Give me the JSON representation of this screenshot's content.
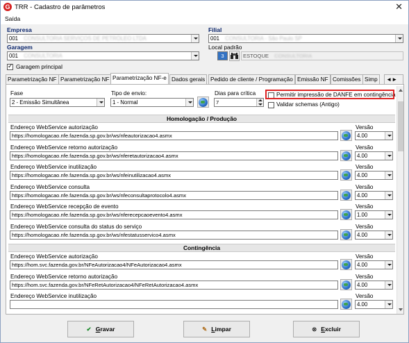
{
  "window": {
    "title": "TRR - Cadastro de parâmetros",
    "close_glyph": "✕",
    "app_icon_letter": "G"
  },
  "menu": {
    "saida": "Saída"
  },
  "empresa": {
    "label": "Empresa",
    "code": "001",
    "name": "CONSULTORIA SERVIÇOS DE PETRÓLEO LTDA"
  },
  "filial": {
    "label": "Filial",
    "code": "001",
    "name": "CONSULTORIA - São Paulo SP"
  },
  "garagem": {
    "label": "Garagem",
    "code": "001",
    "name": "CONSULTORIA"
  },
  "local_padrao": {
    "label": "Local padrão",
    "code": "3",
    "name": "ESTOQUE",
    "suffix": "CONSULTORIA"
  },
  "garagem_principal": {
    "label": "Garagem principal",
    "checked": true
  },
  "tabs": [
    {
      "label": "Parametrização NF"
    },
    {
      "label": "Parametrização NF"
    },
    {
      "label": "Parametrização NF-e"
    },
    {
      "label": "Dados gerais"
    },
    {
      "label": "Pedido de cliente / Programação"
    },
    {
      "label": "Emissão NF"
    },
    {
      "label": "Comissões"
    },
    {
      "label": "Simp"
    },
    {
      "label": "◄►"
    }
  ],
  "fase": {
    "label": "Fase",
    "value": "2 - Emissão Simultânea"
  },
  "tipo_envio": {
    "label": "Tipo de envio:",
    "value": "1 - Normal"
  },
  "dias_critica": {
    "label": "Dias para crítica",
    "value": "7"
  },
  "permitir_danfe": {
    "label": "Permitir impressão de DANFE em contingência",
    "checked": false
  },
  "validar_schemas": {
    "label": "Validar schemas (Antigo)",
    "checked": false
  },
  "homologacao": {
    "title": "Homologação / Produção",
    "rows": [
      {
        "label": "Endereço WebService autorização",
        "url": "https://homologacao.nfe.fazenda.sp.gov.br/ws/nfeautorizacao4.asmx",
        "versao_label": "Versão",
        "versao": "4.00"
      },
      {
        "label": "Endereço WebService retorno autorização",
        "url": "https://homologacao.nfe.fazenda.sp.gov.br/ws/nferetautorizacao4.asmx",
        "versao_label": "Versão",
        "versao": "4.00"
      },
      {
        "label": "Endereço WebService inutilização",
        "url": "https://homologacao.nfe.fazenda.sp.gov.br/ws/nfeinutilizacao4.asmx",
        "versao_label": "Versão",
        "versao": "4.00"
      },
      {
        "label": "Endereço WebService consulta",
        "url": "https://homologacao.nfe.fazenda.sp.gov.br/ws/nfeconsultaprotocolo4.asmx",
        "versao_label": "Versão",
        "versao": "4.00"
      },
      {
        "label": "Endereço WebService recepção de evento",
        "url": "https://homologacao.nfe.fazenda.sp.gov.br/ws/nferecepcaoevento4.asmx",
        "versao_label": "Versão",
        "versao": "1.00"
      },
      {
        "label": "Endereço WebService consulta do status do serviço",
        "url": "https://homologacao.nfe.fazenda.sp.gov.br/ws/nfestatusservico4.asmx",
        "versao_label": "Versão",
        "versao": "4.00"
      }
    ]
  },
  "contingencia": {
    "title": "Contingência",
    "rows": [
      {
        "label": "Endereço WebService autorização",
        "url": "https://hom.svc.fazenda.gov.br/NFeAutorizacao4/NFeAutorizacao4.asmx",
        "versao_label": "Versão",
        "versao": "4.00"
      },
      {
        "label": "Endereço WebService retorno autorização",
        "url": "https://hom.svc.fazenda.gov.br/NFeRetAutorizacao4/NFeRetAutorizacao4.asmx",
        "versao_label": "Versão",
        "versao": "4.00"
      },
      {
        "label": "Endereço WebService inutilização",
        "url": "",
        "versao_label": "Versão",
        "versao": "4.00"
      }
    ]
  },
  "buttons": {
    "gravar": {
      "underlined": "G",
      "rest": "ravar",
      "icon": "✔"
    },
    "limpar": {
      "underlined": "L",
      "rest": "impar",
      "icon": "✎"
    },
    "excluir": {
      "underlined": "E",
      "rest": "xcluir",
      "icon": "⊗"
    }
  },
  "colors": {
    "highlight_border": "#dd2222",
    "label_blue": "#0a246a"
  }
}
